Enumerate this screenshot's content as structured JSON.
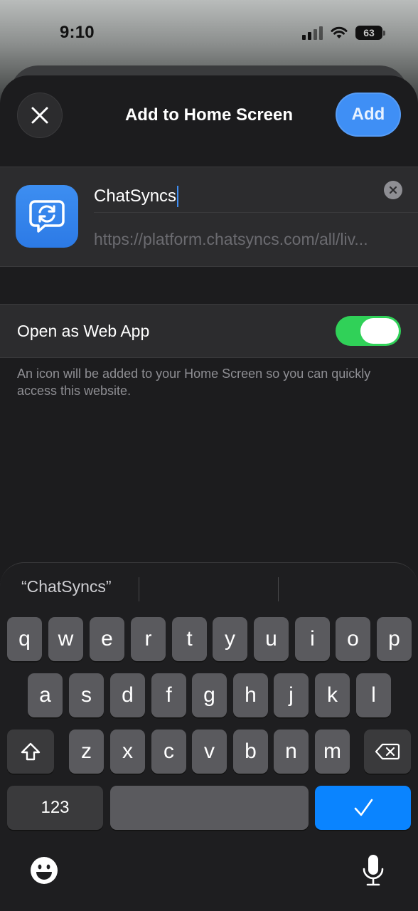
{
  "status_bar": {
    "time": "9:10",
    "battery": "63"
  },
  "sheet": {
    "title": "Add to Home Screen",
    "add_label": "Add",
    "name_value": "ChatSyncs",
    "url": "https://platform.chatsyncs.com/all/liv...",
    "toggle_label": "Open as Web App",
    "toggle_on": true,
    "footnote": "An icon will be added to your Home Screen so you can quickly access this website."
  },
  "keyboard": {
    "suggestions": [
      "“ChatSyncs”",
      "",
      ""
    ],
    "row1": [
      "q",
      "w",
      "e",
      "r",
      "t",
      "y",
      "u",
      "i",
      "o",
      "p"
    ],
    "row2": [
      "a",
      "s",
      "d",
      "f",
      "g",
      "h",
      "j",
      "k",
      "l"
    ],
    "row3": [
      "z",
      "x",
      "c",
      "v",
      "b",
      "n",
      "m"
    ],
    "numbers_label": "123"
  },
  "colors": {
    "accent": "#3f8ff5",
    "toggle_on": "#30d158",
    "done_key": "#0a84ff"
  }
}
